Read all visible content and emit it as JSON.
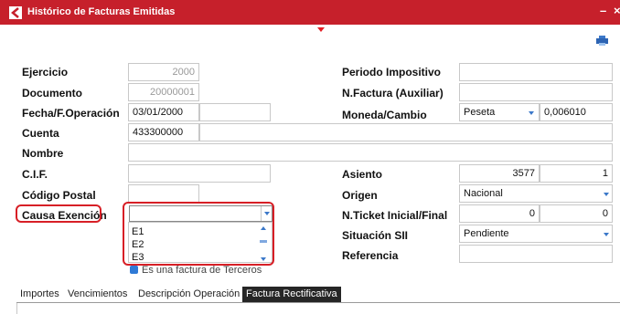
{
  "window": {
    "title": "Histórico de Facturas Emitidas",
    "minimize_glyph": "–",
    "close_glyph": "×",
    "brand_color": "#c6202b"
  },
  "toolbar": {
    "print_icon": "printer-icon"
  },
  "form": {
    "ejercicio": {
      "label": "Ejercicio",
      "value": "2000"
    },
    "documento": {
      "label": "Documento",
      "value": "20000001"
    },
    "fecha": {
      "label": "Fecha/F.Operación",
      "value": "03/01/2000",
      "value2": ""
    },
    "cuenta": {
      "label": "Cuenta",
      "value": "433300000",
      "name": ""
    },
    "nombre": {
      "label": "Nombre",
      "value": ""
    },
    "cif": {
      "label": "C.I.F.",
      "value": ""
    },
    "codigo_postal": {
      "label": "Código Postal",
      "value": ""
    },
    "causa_exencion": {
      "label": "Causa Exención",
      "value": "",
      "options": [
        "E1",
        "E2",
        "E3"
      ]
    },
    "terceros": {
      "label": "Es una factura de Terceros",
      "checked": true
    },
    "periodo_impositivo": {
      "label": "Periodo Impositivo",
      "value": ""
    },
    "nfactura_aux": {
      "label": "N.Factura (Auxiliar)",
      "value": ""
    },
    "moneda": {
      "label": "Moneda/Cambio",
      "value": "Peseta",
      "cambio": "0,006010"
    },
    "asiento": {
      "label": "Asiento",
      "value": "3577",
      "value2": "1"
    },
    "origen": {
      "label": "Origen",
      "value": "Nacional"
    },
    "ticket": {
      "label": "N.Ticket Inicial/Final",
      "inicial": "0",
      "final": "0"
    },
    "situacion_sii": {
      "label": "Situación SII",
      "value": "Pendiente"
    },
    "referencia": {
      "label": "Referencia",
      "value": ""
    }
  },
  "tabs": [
    {
      "label": "Importes"
    },
    {
      "label": "Vencimientos"
    },
    {
      "label": "Descripción Operación"
    },
    {
      "label": "Factura Rectificativa",
      "active": true
    }
  ]
}
